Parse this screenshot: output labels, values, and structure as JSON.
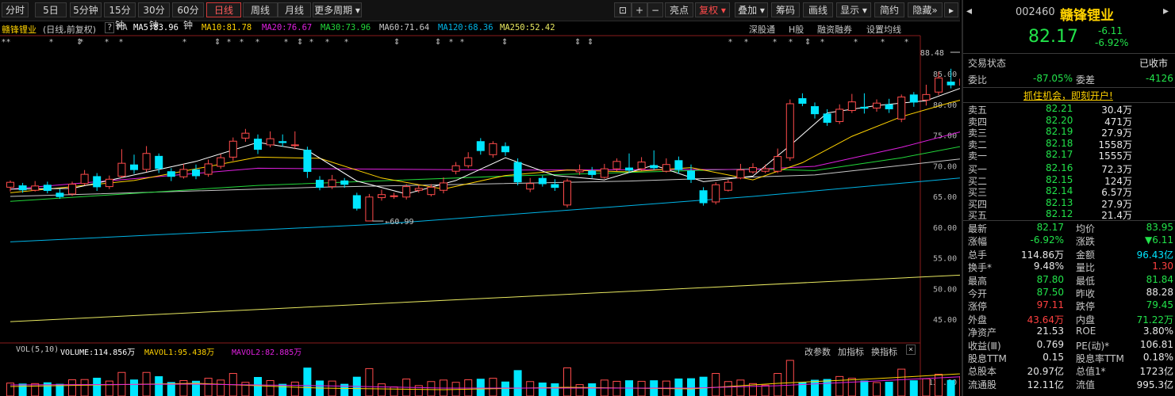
{
  "toolbar": {
    "periods": [
      "分时",
      "5日",
      "5分钟",
      "15分钟",
      "30分钟",
      "60分钟",
      "日线",
      "周线",
      "月线",
      "更多周期"
    ],
    "selected_period": "日线",
    "right_buttons": [
      "亮点",
      "复权",
      "叠加",
      "筹码",
      "画线",
      "显示",
      "简约",
      "隐藏"
    ],
    "fuquan": "复权"
  },
  "ma_bar": {
    "stock_name": "赣锋锂业",
    "mode": "(日线,前复权)",
    "ma_label": "MA",
    "ma5": "MA5:83.96",
    "ma10": "MA10:81.78",
    "ma20": "MA20:76.67",
    "ma30": "MA30:73.96",
    "ma60": "MA60:71.64",
    "ma120": "MA120:68.36",
    "ma250": "MA250:52.42",
    "links": [
      "深股通",
      "H股",
      "融资融券",
      "设置均线"
    ]
  },
  "colors": {
    "up": "#ff4b4b",
    "down": "#00e6ff",
    "ma5": "#ffffff",
    "ma10": "#ffd200",
    "ma20": "#e020e0",
    "ma30": "#22d83a",
    "ma60": "#c8c8c8",
    "ma120": "#00b4e6",
    "ma250": "#e8e860"
  },
  "chart_data": {
    "type": "candlestick",
    "y_ticks": [
      "85.00",
      "80.00",
      "75.00",
      "70.00",
      "65.00",
      "60.00",
      "55.00",
      "50.00",
      "45.00"
    ],
    "annotations": {
      "high_label": "88.48",
      "low_label": "60.99"
    },
    "candles": [
      {
        "o": 66.5,
        "c": 67.3,
        "h": 67.6,
        "l": 65.8
      },
      {
        "o": 66.8,
        "c": 66.0,
        "h": 67.2,
        "l": 65.6
      },
      {
        "o": 66.0,
        "c": 66.7,
        "h": 67.5,
        "l": 65.8
      },
      {
        "o": 66.9,
        "c": 65.9,
        "h": 67.4,
        "l": 65.5
      },
      {
        "o": 65.6,
        "c": 64.9,
        "h": 66.2,
        "l": 64.6
      },
      {
        "o": 65.4,
        "c": 67.0,
        "h": 67.4,
        "l": 65.1
      },
      {
        "o": 67.1,
        "c": 68.6,
        "h": 69.3,
        "l": 66.8
      },
      {
        "o": 68.3,
        "c": 66.5,
        "h": 68.8,
        "l": 65.9
      },
      {
        "o": 66.6,
        "c": 67.8,
        "h": 68.4,
        "l": 66.2
      },
      {
        "o": 68.3,
        "c": 70.4,
        "h": 72.7,
        "l": 68.0
      },
      {
        "o": 70.2,
        "c": 69.3,
        "h": 71.8,
        "l": 68.7
      },
      {
        "o": 69.4,
        "c": 72.0,
        "h": 73.2,
        "l": 69.0
      },
      {
        "o": 71.6,
        "c": 69.5,
        "h": 72.0,
        "l": 68.8
      },
      {
        "o": 69.1,
        "c": 68.2,
        "h": 69.6,
        "l": 67.5
      },
      {
        "o": 68.2,
        "c": 69.4,
        "h": 70.3,
        "l": 67.9
      },
      {
        "o": 69.4,
        "c": 68.3,
        "h": 70.2,
        "l": 67.8
      },
      {
        "o": 68.6,
        "c": 70.3,
        "h": 71.0,
        "l": 68.2
      },
      {
        "o": 69.9,
        "c": 71.3,
        "h": 71.9,
        "l": 69.5
      },
      {
        "o": 71.4,
        "c": 74.0,
        "h": 74.6,
        "l": 70.8
      },
      {
        "o": 74.5,
        "c": 75.3,
        "h": 76.0,
        "l": 73.9
      },
      {
        "o": 74.4,
        "c": 72.6,
        "h": 75.1,
        "l": 71.9
      },
      {
        "o": 73.4,
        "c": 74.4,
        "h": 75.6,
        "l": 73.0
      },
      {
        "o": 74.0,
        "c": 73.7,
        "h": 75.1,
        "l": 73.1
      },
      {
        "o": 73.3,
        "c": 73.4,
        "h": 75.6,
        "l": 72.7
      },
      {
        "o": 72.6,
        "c": 69.0,
        "h": 73.1,
        "l": 68.0
      },
      {
        "o": 67.7,
        "c": 66.4,
        "h": 68.3,
        "l": 66.0
      },
      {
        "o": 66.6,
        "c": 67.7,
        "h": 68.5,
        "l": 66.2
      },
      {
        "o": 67.6,
        "c": 66.9,
        "h": 68.0,
        "l": 66.4
      },
      {
        "o": 65.2,
        "c": 63.0,
        "h": 65.6,
        "l": 62.7
      },
      {
        "o": 61.0,
        "c": 64.9,
        "h": 65.4,
        "l": 60.99
      },
      {
        "o": 64.8,
        "c": 65.3,
        "h": 66.1,
        "l": 64.3
      },
      {
        "o": 65.0,
        "c": 65.1,
        "h": 65.6,
        "l": 64.6
      },
      {
        "o": 64.9,
        "c": 66.6,
        "h": 67.0,
        "l": 64.5
      },
      {
        "o": 66.0,
        "c": 66.3,
        "h": 66.9,
        "l": 65.6
      },
      {
        "o": 65.3,
        "c": 66.5,
        "h": 67.0,
        "l": 65.0
      },
      {
        "o": 66.0,
        "c": 67.2,
        "h": 68.1,
        "l": 65.5
      },
      {
        "o": 69.1,
        "c": 70.0,
        "h": 70.6,
        "l": 68.6
      },
      {
        "o": 70.0,
        "c": 71.3,
        "h": 72.2,
        "l": 69.6
      },
      {
        "o": 74.0,
        "c": 72.4,
        "h": 74.5,
        "l": 71.8
      },
      {
        "o": 71.8,
        "c": 73.6,
        "h": 74.0,
        "l": 71.3
      },
      {
        "o": 73.2,
        "c": 72.2,
        "h": 73.8,
        "l": 71.6
      },
      {
        "o": 70.6,
        "c": 67.3,
        "h": 71.2,
        "l": 66.8
      },
      {
        "o": 66.2,
        "c": 67.1,
        "h": 68.0,
        "l": 65.7
      },
      {
        "o": 68.0,
        "c": 67.0,
        "h": 68.4,
        "l": 66.6
      },
      {
        "o": 67.0,
        "c": 66.4,
        "h": 67.8,
        "l": 65.9
      },
      {
        "o": 63.6,
        "c": 67.5,
        "h": 67.9,
        "l": 63.2
      },
      {
        "o": 69.0,
        "c": 69.3,
        "h": 70.2,
        "l": 68.5
      },
      {
        "o": 69.2,
        "c": 68.5,
        "h": 69.8,
        "l": 68.0
      },
      {
        "o": 68.1,
        "c": 69.5,
        "h": 70.3,
        "l": 67.9
      },
      {
        "o": 69.5,
        "c": 70.7,
        "h": 71.2,
        "l": 69.1
      },
      {
        "o": 69.7,
        "c": 69.2,
        "h": 72.0,
        "l": 68.8
      },
      {
        "o": 69.5,
        "c": 70.6,
        "h": 71.4,
        "l": 69.2
      },
      {
        "o": 70.1,
        "c": 69.6,
        "h": 72.5,
        "l": 69.3
      },
      {
        "o": 69.1,
        "c": 70.2,
        "h": 71.2,
        "l": 68.9
      },
      {
        "o": 70.9,
        "c": 69.3,
        "h": 71.5,
        "l": 68.7
      },
      {
        "o": 69.2,
        "c": 67.7,
        "h": 70.2,
        "l": 67.2
      },
      {
        "o": 66.0,
        "c": 63.9,
        "h": 66.5,
        "l": 63.5
      },
      {
        "o": 64.1,
        "c": 66.9,
        "h": 67.3,
        "l": 63.7
      },
      {
        "o": 66.0,
        "c": 67.3,
        "h": 67.7,
        "l": 65.8
      },
      {
        "o": 68.0,
        "c": 69.3,
        "h": 70.3,
        "l": 67.8
      },
      {
        "o": 69.0,
        "c": 69.7,
        "h": 70.4,
        "l": 68.7
      },
      {
        "o": 69.1,
        "c": 69.5,
        "h": 70.2,
        "l": 68.8
      },
      {
        "o": 69.1,
        "c": 71.5,
        "h": 72.8,
        "l": 68.8
      },
      {
        "o": 71.3,
        "c": 80.1,
        "h": 80.8,
        "l": 70.8
      },
      {
        "o": 81.0,
        "c": 80.1,
        "h": 81.8,
        "l": 79.7
      },
      {
        "o": 79.7,
        "c": 78.4,
        "h": 80.3,
        "l": 77.7
      },
      {
        "o": 78.5,
        "c": 77.0,
        "h": 79.2,
        "l": 76.5
      },
      {
        "o": 77.2,
        "c": 79.2,
        "h": 80.0,
        "l": 76.8
      },
      {
        "o": 79.0,
        "c": 80.4,
        "h": 81.7,
        "l": 78.6
      },
      {
        "o": 79.6,
        "c": 79.3,
        "h": 81.8,
        "l": 78.5
      },
      {
        "o": 79.4,
        "c": 80.2,
        "h": 80.8,
        "l": 78.8
      },
      {
        "o": 80.0,
        "c": 79.2,
        "h": 80.9,
        "l": 78.6
      },
      {
        "o": 77.6,
        "c": 81.2,
        "h": 81.6,
        "l": 77.1
      },
      {
        "o": 81.6,
        "c": 80.3,
        "h": 82.0,
        "l": 79.6
      },
      {
        "o": 80.7,
        "c": 81.6,
        "h": 83.2,
        "l": 79.8
      },
      {
        "o": 82.0,
        "c": 84.3,
        "h": 85.3,
        "l": 81.5
      },
      {
        "o": 83.7,
        "c": 83.1,
        "h": 85.8,
        "l": 82.6
      },
      {
        "o": 83.1,
        "c": 84.1,
        "h": 86.9,
        "l": 82.7
      },
      {
        "o": 84.3,
        "c": 87.5,
        "h": 88.48,
        "l": 83.9
      },
      {
        "o": 87.5,
        "c": 82.17,
        "h": 87.8,
        "l": 81.84
      }
    ],
    "ma_lines": {
      "ma250": [
        [
          0,
          44.6
        ],
        [
          79,
          52.4
        ]
      ],
      "ma120": [
        [
          0,
          57.6
        ],
        [
          30,
          60.5
        ],
        [
          60,
          65.0
        ],
        [
          79,
          68.4
        ]
      ],
      "ma60": [
        [
          0,
          65.0
        ],
        [
          25,
          66.5
        ],
        [
          50,
          67.5
        ],
        [
          65,
          68.5
        ],
        [
          79,
          71.6
        ]
      ],
      "ma30": [
        [
          0,
          64.2
        ],
        [
          20,
          66.8
        ],
        [
          40,
          68.3
        ],
        [
          60,
          69.5
        ],
        [
          65,
          69.2
        ],
        [
          72,
          71.3
        ],
        [
          79,
          74.0
        ]
      ],
      "ma20": [
        [
          0,
          66.2
        ],
        [
          20,
          69.6
        ],
        [
          40,
          69.3
        ],
        [
          60,
          69.4
        ],
        [
          65,
          69.9
        ],
        [
          72,
          73.0
        ],
        [
          79,
          76.7
        ]
      ],
      "ma10": [
        [
          0,
          65.6
        ],
        [
          10,
          67.6
        ],
        [
          20,
          71.4
        ],
        [
          25,
          71.2
        ],
        [
          30,
          68.0
        ],
        [
          35,
          66.2
        ],
        [
          40,
          68.4
        ],
        [
          45,
          69.3
        ],
        [
          50,
          69.0
        ],
        [
          55,
          69.7
        ],
        [
          60,
          67.7
        ],
        [
          64,
          70.5
        ],
        [
          68,
          74.8
        ],
        [
          72,
          78.0
        ],
        [
          76,
          80.3
        ],
        [
          79,
          81.8
        ]
      ],
      "ma5": [
        [
          0,
          66.2
        ],
        [
          5,
          66.3
        ],
        [
          10,
          68.5
        ],
        [
          15,
          70.7
        ],
        [
          20,
          73.8
        ],
        [
          24,
          72.5
        ],
        [
          28,
          67.5
        ],
        [
          32,
          65.4
        ],
        [
          36,
          67.6
        ],
        [
          40,
          71.3
        ],
        [
          44,
          68.4
        ],
        [
          48,
          67.7
        ],
        [
          52,
          70.1
        ],
        [
          56,
          67.4
        ],
        [
          60,
          68.3
        ],
        [
          63,
          73.3
        ],
        [
          66,
          78.6
        ],
        [
          70,
          79.8
        ],
        [
          74,
          80.6
        ],
        [
          77,
          82.8
        ],
        [
          79,
          83.96
        ]
      ]
    },
    "volume": {
      "label": "VOL(5,10)",
      "volume": "VOLUME:114.856万",
      "mavol1": "MAVOL1:95.438万",
      "mavol2": "MAVOL2:82.885万",
      "y_tick": "131.00",
      "tools": [
        "改参数",
        "加指标",
        "换指标"
      ]
    }
  },
  "quote": {
    "code": "002460",
    "name": "赣锋锂业",
    "price": "82.17",
    "change": "-6.11",
    "change_pct": "-6.92%",
    "status_label": "交易状态",
    "status_value": "已收市",
    "weibi_label": "委比",
    "weibi_value": "-87.05%",
    "weicha_label": "委差",
    "weicha_value": "-4126",
    "promo": "抓住机会，即刻开户!",
    "sell": [
      {
        "label": "卖五",
        "price": "82.21",
        "vol": "30.4万"
      },
      {
        "label": "卖四",
        "price": "82.20",
        "vol": "471万"
      },
      {
        "label": "卖三",
        "price": "82.19",
        "vol": "27.9万"
      },
      {
        "label": "卖二",
        "price": "82.18",
        "vol": "1558万"
      },
      {
        "label": "卖一",
        "price": "82.17",
        "vol": "1555万"
      }
    ],
    "buy": [
      {
        "label": "买一",
        "price": "82.16",
        "vol": "72.3万"
      },
      {
        "label": "买二",
        "price": "82.15",
        "vol": "124万"
      },
      {
        "label": "买三",
        "price": "82.14",
        "vol": "6.57万"
      },
      {
        "label": "买四",
        "price": "82.13",
        "vol": "27.9万"
      },
      {
        "label": "买五",
        "price": "82.12",
        "vol": "21.4万"
      }
    ],
    "stats": [
      {
        "l1": "最新",
        "v1": "82.17",
        "c1": "green",
        "l2": "均价",
        "v2": "83.95",
        "c2": "green"
      },
      {
        "l1": "涨幅",
        "v1": "-6.92%",
        "c1": "green",
        "l2": "涨跌",
        "v2": "▼6.11",
        "c2": "green"
      },
      {
        "l1": "总手",
        "v1": "114.86万",
        "c1": "white",
        "l2": "金额",
        "v2": "96.43亿",
        "c2": "cyan"
      },
      {
        "l1": "换手*",
        "v1": "9.48%",
        "c1": "white",
        "l2": "量比",
        "v2": "1.30",
        "c2": "red"
      },
      {
        "l1": "最高",
        "v1": "87.80",
        "c1": "green",
        "l2": "最低",
        "v2": "81.84",
        "c2": "green"
      },
      {
        "l1": "今开",
        "v1": "87.50",
        "c1": "green",
        "l2": "昨收",
        "v2": "88.28",
        "c2": "white"
      },
      {
        "l1": "涨停",
        "v1": "97.11",
        "c1": "red",
        "l2": "跌停",
        "v2": "79.45",
        "c2": "green"
      },
      {
        "l1": "外盘",
        "v1": "43.64万",
        "c1": "red",
        "l2": "内盘",
        "v2": "71.22万",
        "c2": "green"
      },
      {
        "l1": "净资产",
        "v1": "21.53",
        "c1": "white",
        "l2": "ROE",
        "v2": "3.80%",
        "c2": "white"
      },
      {
        "l1": "收益(Ⅲ)",
        "v1": "0.769",
        "c1": "white",
        "l2": "PE(动)*",
        "v2": "106.81",
        "c2": "white"
      },
      {
        "l1": "股息TTM",
        "v1": "0.15",
        "c1": "white",
        "l2": "股息率TTM",
        "v2": "0.18%",
        "c2": "white"
      },
      {
        "l1": "总股本",
        "v1": "20.97亿",
        "c1": "white",
        "l2": "总值1*",
        "v2": "1723亿",
        "c2": "white"
      },
      {
        "l1": "流通股",
        "v1": "12.11亿",
        "c1": "white",
        "l2": "流值",
        "v2": "995.3亿",
        "c2": "white"
      }
    ]
  }
}
